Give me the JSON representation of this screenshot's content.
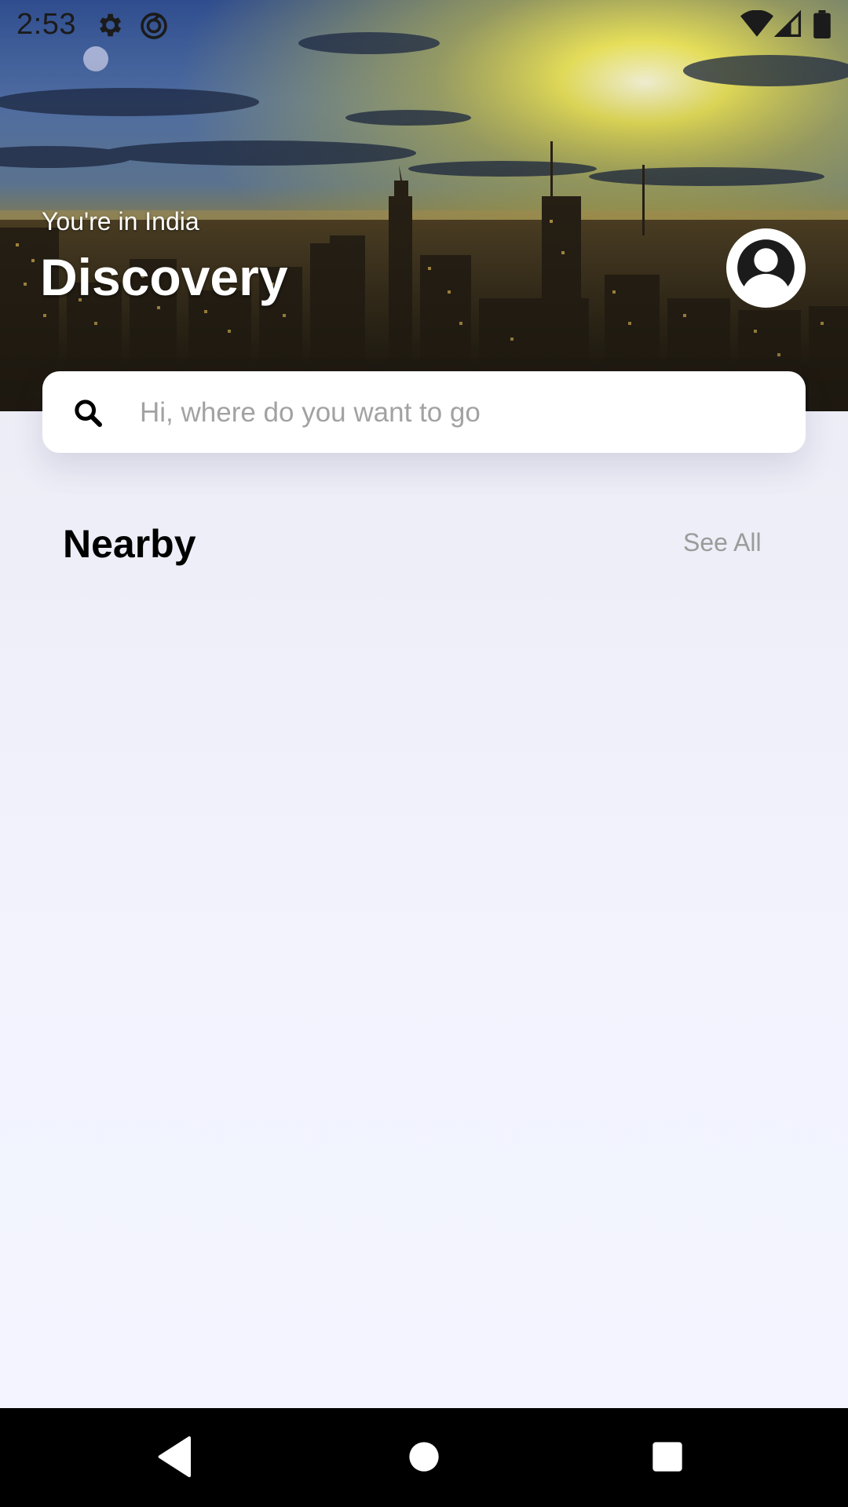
{
  "status_bar": {
    "time": "2:53",
    "icons": [
      "gear-icon",
      "sync-icon",
      "wifi-icon",
      "signal-icon",
      "battery-icon"
    ]
  },
  "header": {
    "location": "You're in India",
    "title": "Discovery",
    "avatar_icon": "user-avatar-icon"
  },
  "search": {
    "placeholder": "Hi, where do you want to go",
    "value": "",
    "icon": "search-icon"
  },
  "nearby": {
    "title": "Nearby",
    "see_all_label": "See All"
  },
  "nav_bar": {
    "buttons": [
      "back-icon",
      "home-icon",
      "recents-icon"
    ]
  },
  "colors": {
    "background_top": "#e9e9f2",
    "background_bottom": "#f3f4ff",
    "search_placeholder": "#a2a2a2",
    "see_all": "#9b9b9b",
    "nav_bar": "#000000"
  }
}
